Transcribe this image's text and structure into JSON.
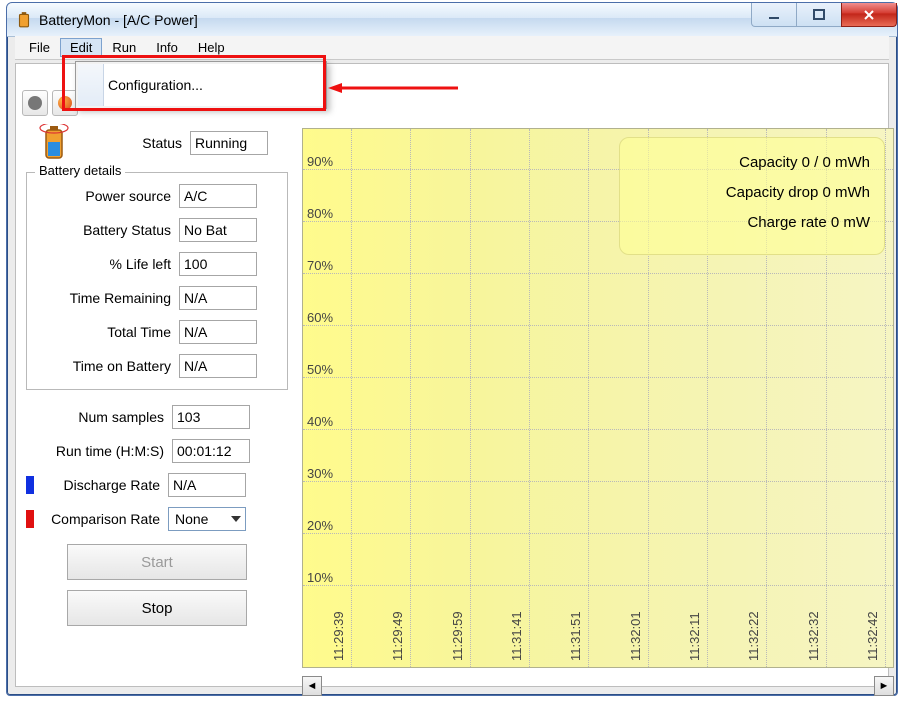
{
  "window": {
    "title": "BatteryMon - [A/C Power]"
  },
  "menu": {
    "items": [
      "File",
      "Edit",
      "Run",
      "Info",
      "Help"
    ],
    "open_index": 1,
    "dropdown": {
      "item0": "Configuration..."
    }
  },
  "status": {
    "label": "Status",
    "value": "Running"
  },
  "details": {
    "legend": "Battery details",
    "power_source": {
      "label": "Power source",
      "value": "A/C"
    },
    "battery_status": {
      "label": "Battery Status",
      "value": "No Bat"
    },
    "life_left": {
      "label": "% Life left",
      "value": "100"
    },
    "time_remaining": {
      "label": "Time Remaining",
      "value": "N/A"
    },
    "total_time": {
      "label": "Total Time",
      "value": "N/A"
    },
    "time_on_battery": {
      "label": "Time on Battery",
      "value": "N/A"
    }
  },
  "stats": {
    "num_samples": {
      "label": "Num samples",
      "value": "103"
    },
    "run_time": {
      "label": "Run time (H:M:S)",
      "value": "00:01:12"
    },
    "discharge_rate": {
      "label": "Discharge Rate",
      "value": "N/A"
    },
    "comparison_rate": {
      "label": "Comparison Rate",
      "value": "None"
    }
  },
  "buttons": {
    "start": "Start",
    "stop": "Stop"
  },
  "overlay": {
    "capacity": "Capacity 0 / 0 mWh",
    "capacity_drop": "Capacity drop 0 mWh",
    "charge_rate": "Charge rate 0 mW"
  },
  "chart_data": {
    "type": "line",
    "title": "",
    "xlabel": "",
    "ylabel": "",
    "ylim": [
      0,
      100
    ],
    "y_ticks": [
      "90%",
      "80%",
      "70%",
      "60%",
      "50%",
      "40%",
      "30%",
      "20%",
      "10%"
    ],
    "x_ticks": [
      "11:29:39",
      "11:29:49",
      "11:29:59",
      "11:31:41",
      "11:31:51",
      "11:32:01",
      "11:32:11",
      "11:32:22",
      "11:32:32",
      "11:32:42"
    ],
    "series": [
      {
        "name": "Discharge Rate",
        "color": "#1030e0",
        "values": []
      },
      {
        "name": "Comparison Rate",
        "color": "#e01010",
        "values": []
      }
    ]
  }
}
